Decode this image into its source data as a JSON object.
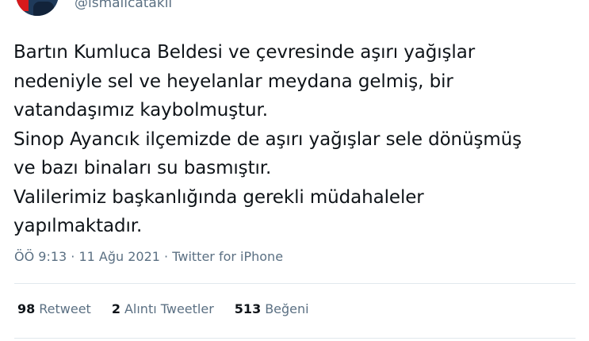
{
  "header": {
    "handle": "@ismailcatakli"
  },
  "tweet": {
    "text": "Bartın Kumluca Beldesi ve çevresinde aşırı yağışlar\nnedeniyle sel ve heyelanlar meydana gelmiş, bir\nvatandaşımız kaybolmuştur.\nSinop Ayancık ilçemizde de aşırı yağışlar sele dönüşmüş\nve bazı binaları su basmıştır.\nValilerimiz başkanlığında gerekli müdahaleler\nyapılmaktadır."
  },
  "meta": {
    "time": "ÖÖ 9:13",
    "sep1": " · ",
    "date": "11 Ağu 2021",
    "sep2": " · ",
    "source": "Twitter for iPhone"
  },
  "stats": {
    "retweets": {
      "count": "98",
      "label": "Retweet"
    },
    "quotes": {
      "count": "2",
      "label": "Alıntı Tweetler"
    },
    "likes": {
      "count": "513",
      "label": "Beğeni"
    }
  }
}
